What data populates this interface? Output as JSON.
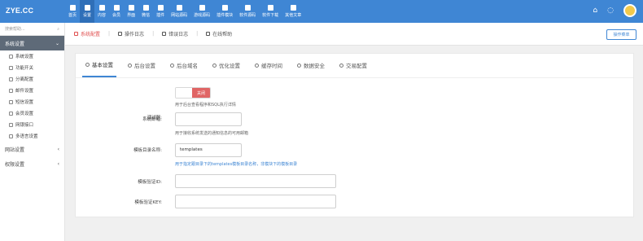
{
  "app": {
    "logo": "ZYE.CC"
  },
  "topnav": [
    {
      "label": "首页",
      "icon": "home-icon"
    },
    {
      "label": "设置",
      "icon": "gear-icon",
      "active": true
    },
    {
      "label": "内容",
      "icon": "grid-icon"
    },
    {
      "label": "会员",
      "icon": "user-icon"
    },
    {
      "label": "界面",
      "icon": "layout-icon"
    },
    {
      "label": "微信",
      "icon": "wechat-icon"
    },
    {
      "label": "插件",
      "icon": "plugin-icon"
    },
    {
      "label": "网站源码",
      "icon": "code-icon"
    },
    {
      "label": "游戏源码",
      "icon": "gamepad-icon"
    },
    {
      "label": "插件模块",
      "icon": "module-icon"
    },
    {
      "label": "软件源码",
      "icon": "software-icon"
    },
    {
      "label": "软件下载",
      "icon": "download-icon"
    },
    {
      "label": "其他文章",
      "icon": "article-icon"
    }
  ],
  "topright": {
    "home": "⌂",
    "refresh": "◌",
    "avatar": "avatar-icon"
  },
  "sidebar": {
    "search_placeholder": "搜索帮助...",
    "groups": [
      {
        "label": "系统设置",
        "active": true
      },
      {
        "label": "网站设置"
      },
      {
        "label": "权限设置"
      }
    ],
    "items": [
      "系统设置",
      "功能开关",
      "分离配置",
      "邮件设置",
      "短信设置",
      "会员设置",
      "网银接口",
      "多语言设置"
    ]
  },
  "breadcrumb": {
    "items": [
      "系统配置",
      "操作日志",
      "错误日志",
      "在线帮助"
    ],
    "op_button": "操作菜单"
  },
  "tabs": [
    "基本设置",
    "后台设置",
    "后台域名",
    "优化设置",
    "缓存时间",
    "数据安全",
    "交易配置"
  ],
  "form": {
    "debug_label": "调试器:",
    "debug_toggle": "关闭",
    "debug_help": "用于后台查看程序和SQL执行详情",
    "email_label": "系统邮箱:",
    "email_value": "",
    "email_help": "用于接收系统发送的通知信息的可用邮箱",
    "tpl_label": "模板目录名称:",
    "tpl_value": "templates",
    "tpl_help": "用于指定跟目录下的templates模板目录名称，非模块下的模板目录",
    "id_label": "模板验证ID:",
    "id_value": "",
    "key_label": "模板验证KEY:",
    "key_value": ""
  }
}
